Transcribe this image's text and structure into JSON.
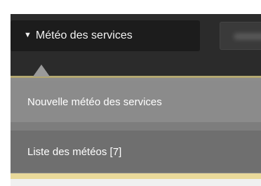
{
  "navbar": {
    "menu_button_label": "Météo des services"
  },
  "menu": {
    "items": [
      {
        "label": "Nouvelle météo des services"
      },
      {
        "label": "Liste des météos [7]"
      }
    ]
  },
  "colors": {
    "topbar": "#2b2b2b",
    "menu_button": "#1c1c1c",
    "dropdown": "#8c8c8c",
    "item_selected": "#6f6f6f",
    "accent": "#b7aa73",
    "highlight": "#e9d99a"
  }
}
